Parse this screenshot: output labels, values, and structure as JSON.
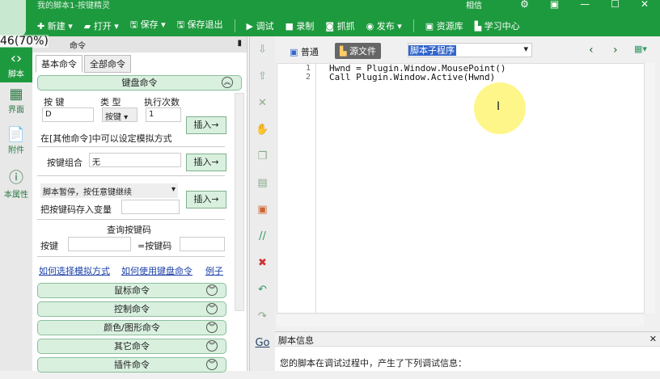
{
  "window": {
    "title": "我的脚本1-按键精灵",
    "brand": "相信",
    "controls": [
      "⚙",
      "▣",
      "—",
      "☐",
      "✕"
    ]
  },
  "overlay": "46(70%)",
  "toolbar": [
    {
      "icon": "plus-icon",
      "glyph": "✚",
      "label": "新建 ▾"
    },
    {
      "icon": "folder-icon",
      "glyph": "▰",
      "label": "打开 ▾"
    },
    {
      "icon": "save-icon",
      "glyph": "🖫",
      "label": "保存 ▾"
    },
    {
      "icon": "save-exit-icon",
      "glyph": "🖫",
      "label": "保存退出"
    },
    {
      "icon": "debug-icon",
      "glyph": "▶",
      "label": "调试"
    },
    {
      "icon": "record-icon",
      "glyph": "■",
      "label": "录制"
    },
    {
      "icon": "capture-icon",
      "glyph": "◙",
      "label": "抓抓"
    },
    {
      "icon": "publish-icon",
      "glyph": "◉",
      "label": "发布 ▾"
    },
    {
      "icon": "resource-icon",
      "glyph": "▣",
      "label": "资源库"
    },
    {
      "icon": "learn-icon",
      "glyph": "▙",
      "label": "学习中心"
    }
  ],
  "sidebar": [
    {
      "label": "脚本",
      "glyph": "‹›",
      "active": true
    },
    {
      "label": "界面",
      "glyph": "▦"
    },
    {
      "label": "附件",
      "glyph": "📄"
    },
    {
      "label": "本属性",
      "glyph": "ⓘ"
    }
  ],
  "panel": {
    "title": "命令",
    "tabs": [
      "基本命令",
      "全部命令"
    ],
    "keyboard": {
      "header": "键盘命令",
      "key_label": "按 键",
      "key_value": "D",
      "type_label": "类 型",
      "type_value": "按键",
      "count_label": "执行次数",
      "count_value": "1",
      "insert": "插入→",
      "hint": "在[其他命令]中可以设定模拟方式",
      "combo_label": "按键组合",
      "combo_value": "无",
      "pause_select": "脚本暂停，按任意键继续",
      "store_label": "把按键码存入变量",
      "query_title": "查询按键码",
      "query_key": "按键",
      "query_code": "=按键码"
    },
    "links": [
      "如何选择模拟方式",
      "如何使用键盘命令",
      "例子"
    ],
    "groups": [
      "鼠标命令",
      "控制命令",
      "颜色/图形命令",
      "其它命令",
      "插件命令"
    ]
  },
  "editor": {
    "mode_normal": "普通",
    "mode_source": "源文件",
    "sub_select": "脚本子程序",
    "lines": [
      "Hwnd = Plugin.Window.MousePoint()",
      "Call Plugin.Window.Active(Hwnd)"
    ]
  },
  "info": {
    "title": "脚本信息",
    "message": "您的脚本在调试过程中，产生了下列调试信息："
  }
}
